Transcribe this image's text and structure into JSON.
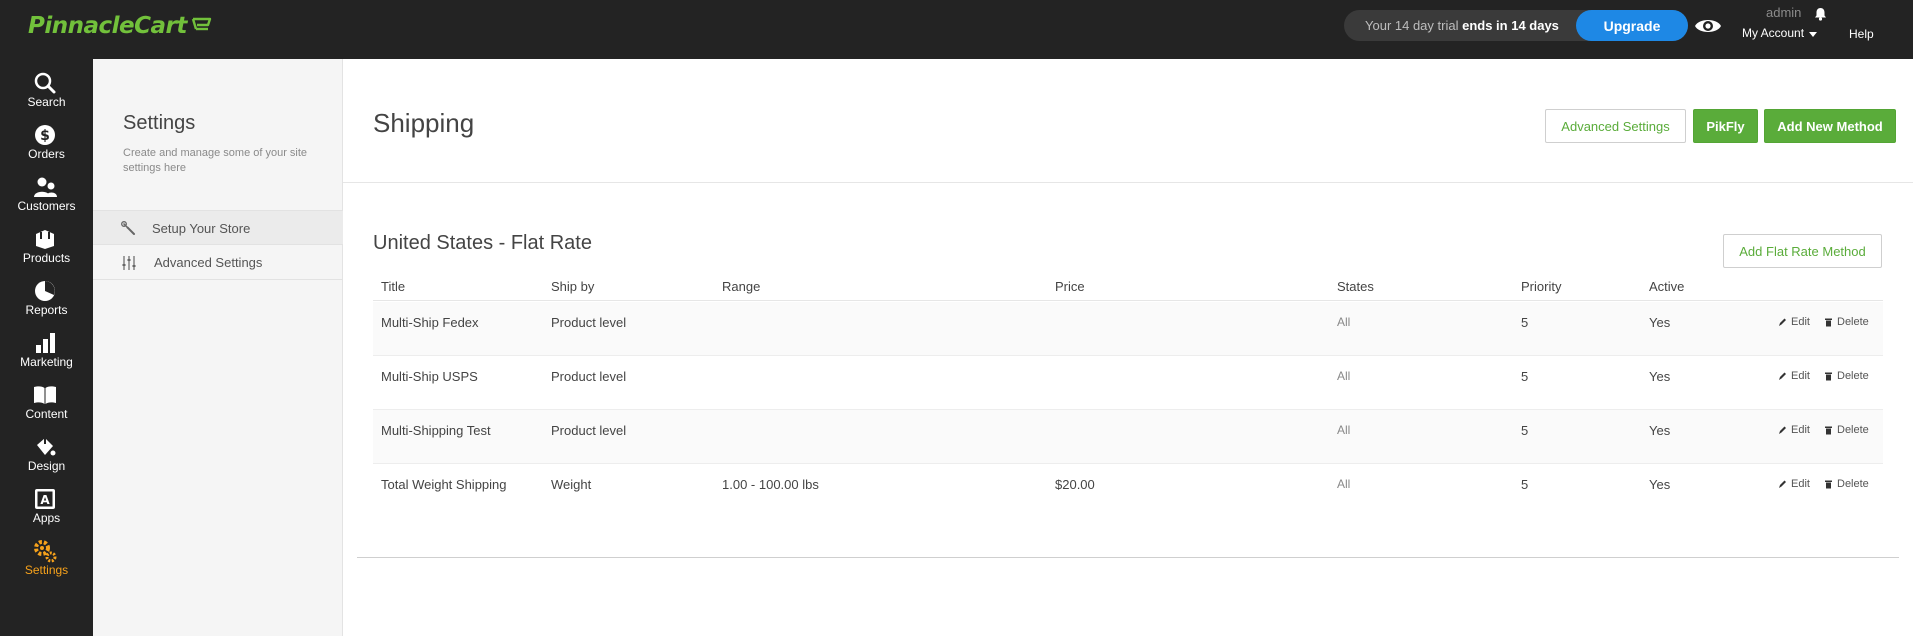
{
  "brand": {
    "name": "PinnacleCart",
    "color": "#72c13b"
  },
  "header": {
    "trial_prefix": "Your 14 day trial ",
    "trial_bold": "ends in 14 days",
    "upgrade_label": "Upgrade",
    "admin_name": "admin",
    "my_account_label": "My Account",
    "help_label": "Help"
  },
  "leftnav": {
    "items": [
      {
        "label": "Search",
        "icon": "search-icon"
      },
      {
        "label": "Orders",
        "icon": "dollar-icon"
      },
      {
        "label": "Customers",
        "icon": "users-icon"
      },
      {
        "label": "Products",
        "icon": "box-icon"
      },
      {
        "label": "Reports",
        "icon": "pie-chart-icon"
      },
      {
        "label": "Marketing",
        "icon": "bar-chart-icon"
      },
      {
        "label": "Content",
        "icon": "book-icon"
      },
      {
        "label": "Design",
        "icon": "paint-icon"
      },
      {
        "label": "Apps",
        "icon": "apps-icon"
      },
      {
        "label": "Settings",
        "icon": "gears-icon"
      }
    ],
    "active": "Settings",
    "active_color": "#f7a21b"
  },
  "subpanel": {
    "title": "Settings",
    "description": "Create and manage some of your site settings here",
    "items": [
      {
        "label": "Setup Your Store",
        "icon": "wrench-icon"
      },
      {
        "label": "Advanced Settings",
        "icon": "sliders-icon"
      }
    ]
  },
  "main": {
    "title": "Shipping",
    "buttons": {
      "advanced_settings": "Advanced Settings",
      "pikfly": "PikFly",
      "add_new_method": "Add New Method"
    },
    "section": {
      "title": "United States - Flat Rate",
      "add_button": "Add Flat Rate Method",
      "columns": [
        "Title",
        "Ship by",
        "Range",
        "Price",
        "States",
        "Priority",
        "Active"
      ],
      "rows": [
        {
          "title": "Multi-Ship Fedex",
          "ship_by": "Product level",
          "range": "",
          "price": "",
          "states": "All",
          "priority": "5",
          "active": "Yes"
        },
        {
          "title": "Multi-Ship USPS",
          "ship_by": "Product level",
          "range": "",
          "price": "",
          "states": "All",
          "priority": "5",
          "active": "Yes"
        },
        {
          "title": "Multi-Shipping Test",
          "ship_by": "Product level",
          "range": "",
          "price": "",
          "states": "All",
          "priority": "5",
          "active": "Yes"
        },
        {
          "title": "Total Weight Shipping",
          "ship_by": "Weight",
          "range": "1.00 - 100.00 lbs",
          "price": "$20.00",
          "states": "All",
          "priority": "5",
          "active": "Yes"
        }
      ],
      "edit_label": "Edit",
      "delete_label": "Delete"
    }
  }
}
